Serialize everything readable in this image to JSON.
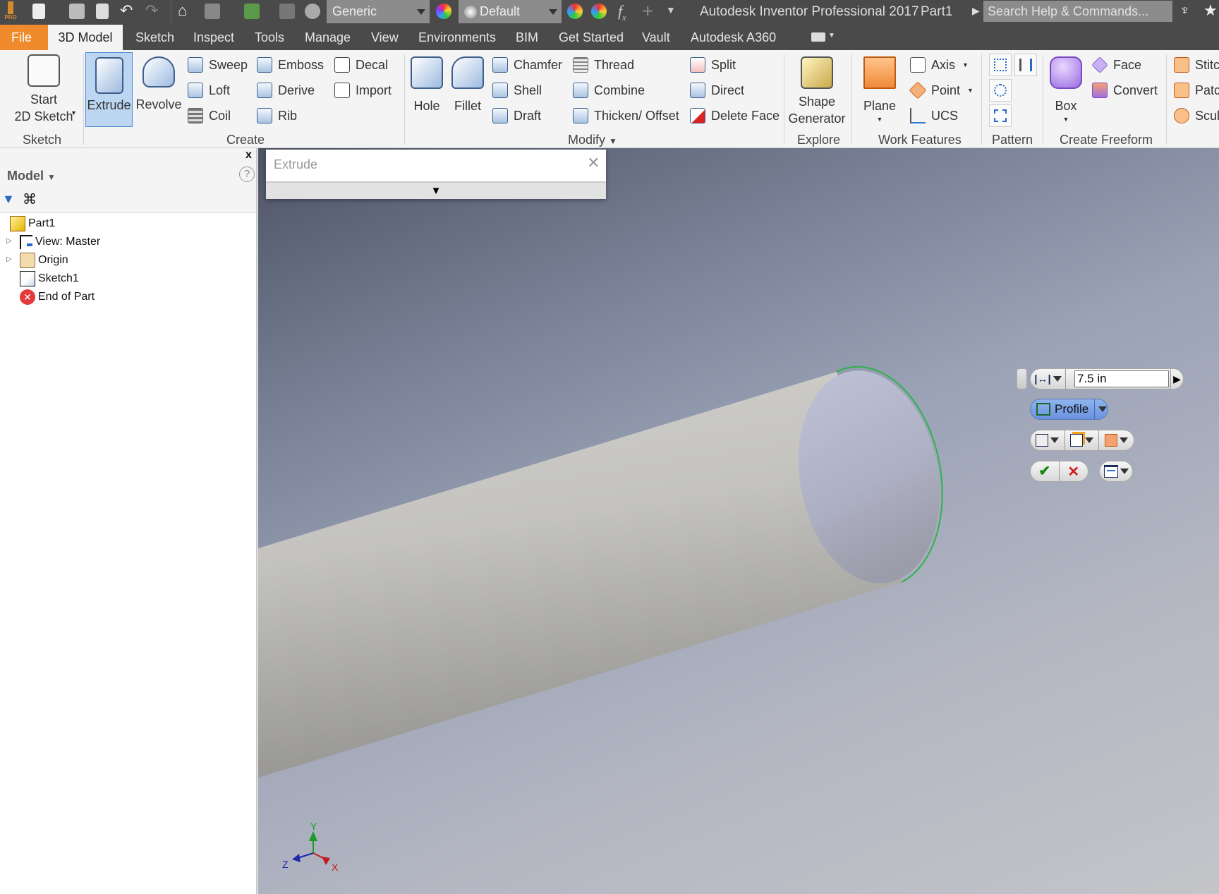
{
  "titlebar": {
    "app_title": "Autodesk Inventor Professional 2017",
    "document": "Part1",
    "material_combo": "Generic",
    "appearance_combo": "Default",
    "search_placeholder": "Search Help & Commands...",
    "logo_text": "PRO"
  },
  "tabs": [
    "File",
    "3D Model",
    "Sketch",
    "Inspect",
    "Tools",
    "Manage",
    "View",
    "Environments",
    "BIM",
    "Get Started",
    "Vault",
    "Autodesk A360"
  ],
  "active_tab": "3D Model",
  "ribbon": {
    "sketch": {
      "start_line1": "Start",
      "start_line2": "2D Sketch",
      "label": "Sketch"
    },
    "create": {
      "extrude": "Extrude",
      "revolve": "Revolve",
      "sweep": "Sweep",
      "loft": "Loft",
      "coil": "Coil",
      "emboss": "Emboss",
      "derive": "Derive",
      "rib": "Rib",
      "decal": "Decal",
      "import": "Import",
      "label": "Create"
    },
    "modify": {
      "hole": "Hole",
      "fillet": "Fillet",
      "chamfer": "Chamfer",
      "shell": "Shell",
      "draft": "Draft",
      "thread": "Thread",
      "combine": "Combine",
      "thicken": "Thicken/ Offset",
      "split": "Split",
      "direct": "Direct",
      "delete_face": "Delete Face",
      "label": "Modify"
    },
    "explore": {
      "shape_line1": "Shape",
      "shape_line2": "Generator",
      "label": "Explore"
    },
    "work_features": {
      "plane": "Plane",
      "axis": "Axis",
      "point": "Point",
      "ucs": "UCS",
      "label": "Work Features"
    },
    "pattern": {
      "label": "Pattern"
    },
    "freeform": {
      "box": "Box",
      "face": "Face",
      "convert": "Convert",
      "label": "Create Freeform"
    },
    "surface": {
      "stitch": "Stitc",
      "patch": "Patc",
      "sculpt": "Scul"
    }
  },
  "browser": {
    "title": "Model",
    "tree": [
      {
        "label": "Part1",
        "icon": "part-icon"
      },
      {
        "label": "View: Master",
        "icon": "view-icon"
      },
      {
        "label": "Origin",
        "icon": "folder-icon"
      },
      {
        "label": "Sketch1",
        "icon": "sketch-icon"
      },
      {
        "label": "End of Part",
        "icon": "end-of-part-icon"
      }
    ]
  },
  "extrude_dialog": {
    "title": "Extrude"
  },
  "minitoolbar": {
    "distance": "7.5 in",
    "profile": "Profile"
  },
  "triad": {
    "x": "X",
    "y": "Y",
    "z": "Z"
  },
  "colors": {
    "file_tab": "#ef8a2d",
    "selection_edge": "#2db34a",
    "active_button": "#bcd6f2"
  }
}
